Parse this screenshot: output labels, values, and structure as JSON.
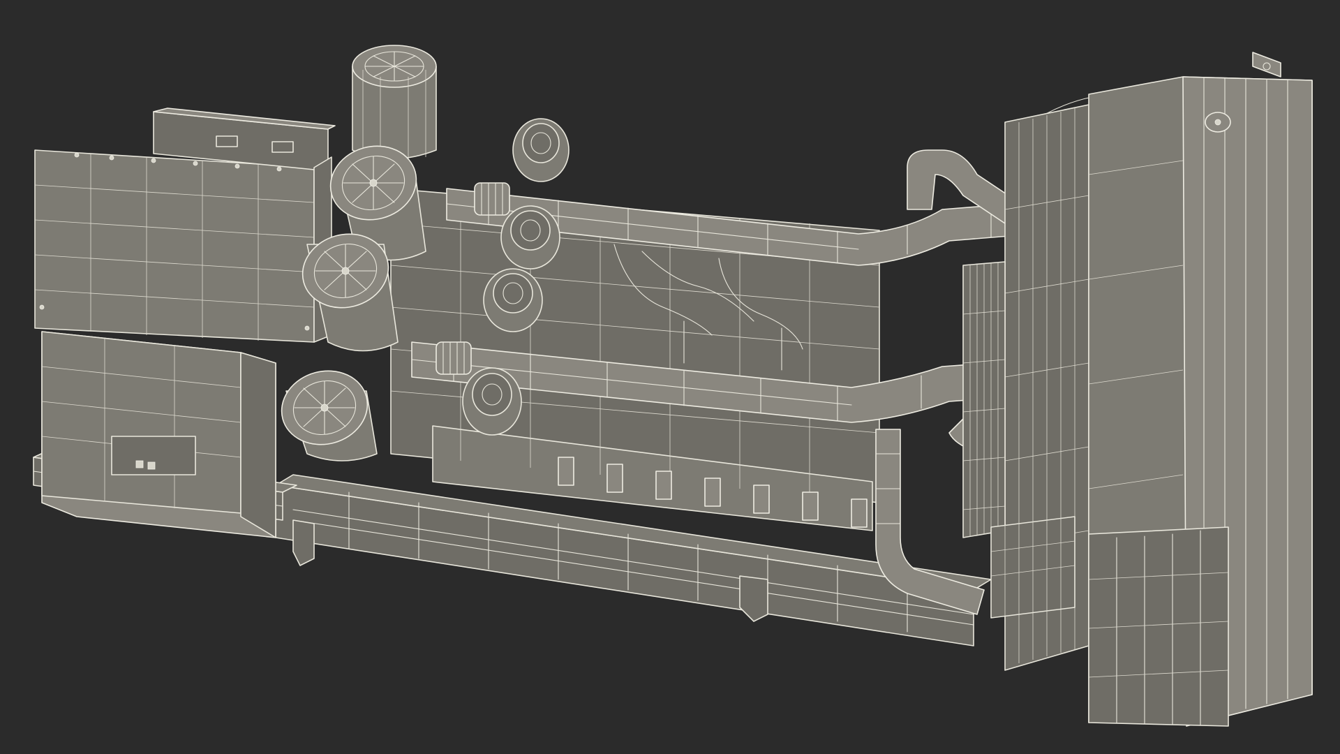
{
  "image": {
    "subject": "",
    "colors": {
      "background": "#2b2b2b",
      "model_fill": "#7d7b73",
      "wire_stroke": "#e9e7dc"
    }
  }
}
